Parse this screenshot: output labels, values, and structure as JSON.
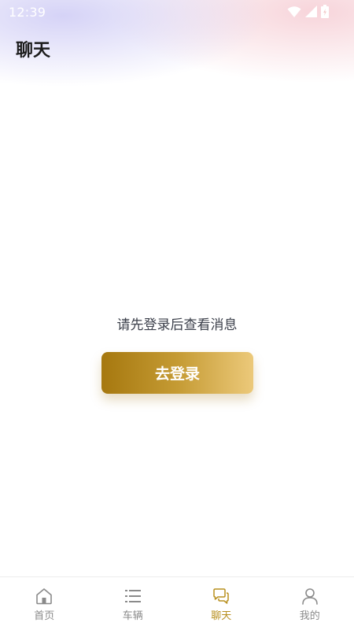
{
  "status_bar": {
    "time": "12:39",
    "icons": [
      "wifi-icon",
      "signal-icon",
      "battery-icon"
    ]
  },
  "header": {
    "title": "聊天"
  },
  "main": {
    "empty_message": "请先登录后查看消息",
    "login_button_label": "去登录"
  },
  "tab_bar": {
    "tabs": [
      {
        "label": "首页",
        "icon": "home-icon",
        "active": false
      },
      {
        "label": "车辆",
        "icon": "list-icon",
        "active": false
      },
      {
        "label": "聊天",
        "icon": "chat-icon",
        "active": true
      },
      {
        "label": "我的",
        "icon": "user-icon",
        "active": false
      }
    ]
  },
  "colors": {
    "accent": "#b8901f",
    "button_gradient_start": "#a6780f",
    "button_gradient_end": "#ecc97a",
    "inactive_tab": "#8a8a8a"
  }
}
